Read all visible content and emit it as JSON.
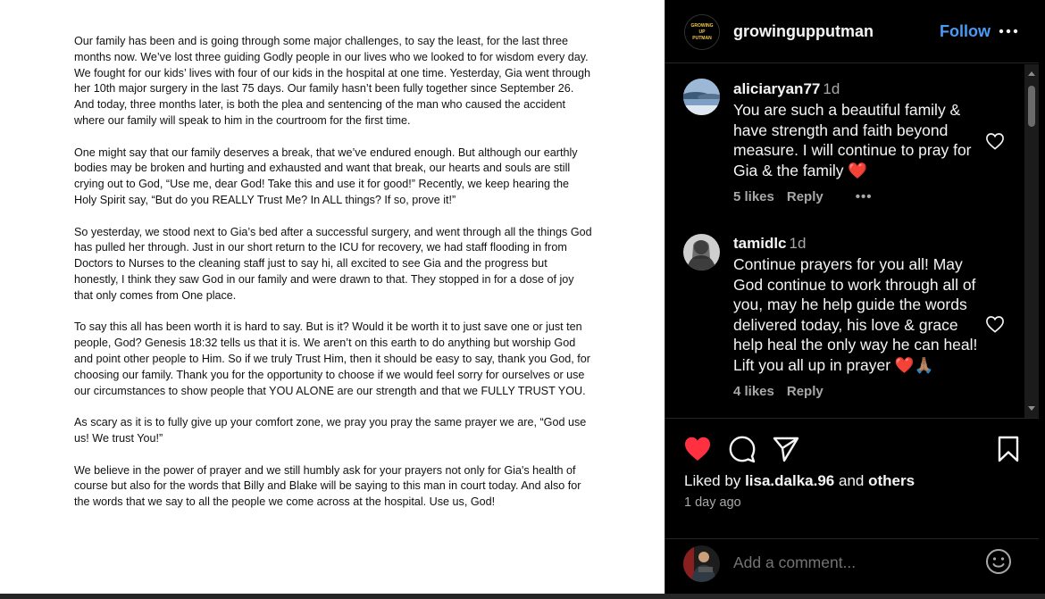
{
  "post": {
    "paragraphs": [
      "Our family has been and is going through some major challenges, to say the least, for the last three months now. We’ve lost three guiding Godly people in our lives who we looked to for wisdom every day. We fought for our kids’ lives with four of our kids in the hospital at one time. Yesterday, Gia went through her 10th major surgery in the last 75 days. Our family hasn’t been fully together since September 26. And today, three months later, is both the plea and sentencing of the man who caused the accident where our family will speak to him in the courtroom for the first time.",
      "One might say that our family deserves a break, that we’ve endured enough. But although our earthly bodies may be broken and hurting and exhausted and want that break, our hearts and souls are still crying out to God, “Use me, dear God! Take this and use it for good!” Recently, we keep hearing the Holy Spirit say, “But do you REALLY Trust Me? In ALL things? If so, prove it!”",
      "So yesterday, we stood next to Gia’s bed after a successful surgery, and went through all the things God has pulled her through. Just in our short return to the ICU for recovery, we had staff flooding in from Doctors to Nurses to the cleaning staff just to say hi, all excited to see Gia and the progress but honestly, I think they saw God in our family and were drawn to that. They stopped in for a dose of joy that only comes from One place.",
      "To say this all has been worth it is hard to say. But is it? Would it be worth it to just save one or just ten people, God? Genesis 18:32 tells us that it is. We aren’t on this earth to do anything but worship God and point other people to Him. So if we truly Trust Him, then it should be easy to say, thank you God, for choosing our family. Thank you for the opportunity to choose if we would feel sorry for ourselves or use our circumstances to show people that YOU ALONE are our strength and that we FULLY TRUST YOU.",
      "As scary as it is to fully give up your comfort zone, we pray you pray the same prayer we are, “God use us! We trust You!”",
      "We believe in the power of prayer and we still humbly ask for your prayers not only for Gia's health of course but also for the words that Billy and Blake will be saying to this man in court today. And also for the words that we say to all the people we come across at the hospital. Use us, God!"
    ]
  },
  "header": {
    "logo_lines": [
      "GROWING",
      "UP",
      "PUTMAN"
    ],
    "username": "growingupputman",
    "follow_label": "Follow",
    "more_icon": "more-horizontal-icon"
  },
  "comments": [
    {
      "username": "aliciaryan77",
      "time": "1d",
      "text": "You are such a beautiful family & have strength and faith beyond measure. I will continue to pray for Gia & the family ❤️",
      "likes": "5 likes",
      "reply": "Reply",
      "more": "•••"
    },
    {
      "username": "tamidlc",
      "time": "1d",
      "text": "Continue prayers for you all! May God continue to work through all of you, may he help guide the words delivered today, his love & grace help heal the only way he can heal! Lift you all up in prayer ❤️🙏🏽",
      "likes": "4 likes",
      "reply": "Reply"
    }
  ],
  "actions": {
    "liked_prefix": "Liked by",
    "liked_user": "lisa.dalka.96",
    "liked_and": "and",
    "liked_others": "others",
    "time_ago": "1 day ago"
  },
  "add_comment": {
    "placeholder": "Add a comment..."
  },
  "colors": {
    "accent": "#4a9bf7",
    "like_red": "#ff3040",
    "background": "#000000",
    "muted": "#a8a8a8"
  }
}
